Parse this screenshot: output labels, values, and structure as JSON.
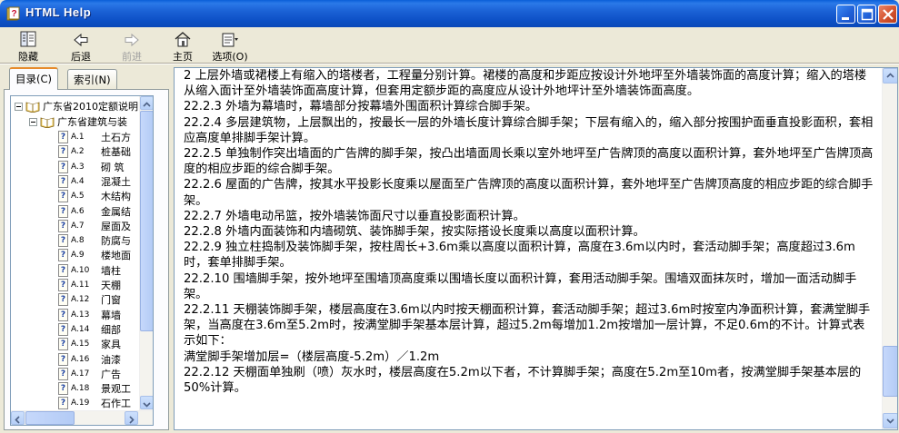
{
  "window": {
    "title": "HTML Help"
  },
  "toolbar": {
    "hide_label": "隐藏",
    "back_label": "后退",
    "forward_label": "前进",
    "home_label": "主页",
    "options_label": "选项(O)"
  },
  "tabs": {
    "contents_label": "目录(C)",
    "index_label": "索引(N)"
  },
  "tree": {
    "root": "广东省2010定额说明",
    "child": "广东省建筑与装",
    "items": [
      {
        "code": "A.1",
        "text": "土石方"
      },
      {
        "code": "A.2",
        "text": "桩基础"
      },
      {
        "code": "A.3",
        "text": "砌  筑"
      },
      {
        "code": "A.4",
        "text": "混凝土"
      },
      {
        "code": "A.5",
        "text": "木结构"
      },
      {
        "code": "A.6",
        "text": "金属结"
      },
      {
        "code": "A.7",
        "text": "屋面及"
      },
      {
        "code": "A.8",
        "text": "防腐与"
      },
      {
        "code": "A.9",
        "text": "楼地面"
      },
      {
        "code": "A.10",
        "text": "墙柱"
      },
      {
        "code": "A.11",
        "text": "天棚"
      },
      {
        "code": "A.12",
        "text": "门窗"
      },
      {
        "code": "A.13",
        "text": "幕墙"
      },
      {
        "code": "A.14",
        "text": "细部"
      },
      {
        "code": "A.15",
        "text": "家具"
      },
      {
        "code": "A.16",
        "text": "油漆"
      },
      {
        "code": "A.17",
        "text": "广告"
      },
      {
        "code": "A.18",
        "text": "景观工"
      },
      {
        "code": "A.19",
        "text": "石作工"
      }
    ]
  },
  "content": {
    "paragraphs": [
      "    2  上层外墙或裙楼上有缩入的塔楼者，工程量分别计算。裙楼的高度和步距应按设计外地坪至外墙装饰面的高度计算；缩入的塔楼从缩入面计至外墙装饰面高度计算，但套用定额步距的高度应从设计外地坪计至外墙装饰面高度。",
      "22.2.3  外墙为幕墙时，幕墙部分按幕墙外围面积计算综合脚手架。",
      "22.2.4  多层建筑物，上层飘出的，按最长一层的外墙长度计算综合脚手架；下层有缩入的，缩入部分按围护面垂直投影面积，套相应高度单排脚手架计算。",
      "22.2.5  单独制作突出墙面的广告牌的脚手架，按凸出墙面周长乘以室外地坪至广告牌顶的高度以面积计算，套外地坪至广告牌顶高度的相应步距的综合脚手架。",
      "22.2.6  屋面的广告牌，按其水平投影长度乘以屋面至广告牌顶的高度以面积计算，套外地坪至广告牌顶高度的相应步距的综合脚手架。",
      "22.2.7  外墙电动吊篮，按外墙装饰面尺寸以垂直投影面积计算。",
      "22.2.8  外墙内面装饰和内墙砌筑、装饰脚手架，按实际搭设长度乘以高度以面积计算。",
      "22.2.9  独立柱捣制及装饰脚手架，按柱周长+3.6m乘以高度以面积计算，高度在3.6m以内时，套活动脚手架；高度超过3.6m时，套单排脚手架。",
      "22.2.10  围墙脚手架，按外地坪至围墙顶高度乘以围墙长度以面积计算，套用活动脚手架。围墙双面抹灰时，增加一面活动脚手架。",
      "22.2.11  天棚装饰脚手架，楼层高度在3.6m以内时按天棚面积计算，套活动脚手架；超过3.6m时按室内净面积计算，套满堂脚手架，当高度在3.6m至5.2m时，按满堂脚手架基本层计算，超过5.2m每增加1.2m按增加一层计算，不足0.6m的不计。计算式表示如下：",
      "    满堂脚手架增加层=（楼层高度-5.2m）／1.2m",
      "22.2.12  天棚面单独刷（喷）灰水时，楼层高度在5.2m以下者，不计算脚手架；高度在5.2m至10m者，按满堂脚手架基本层的50%计算。"
    ]
  }
}
